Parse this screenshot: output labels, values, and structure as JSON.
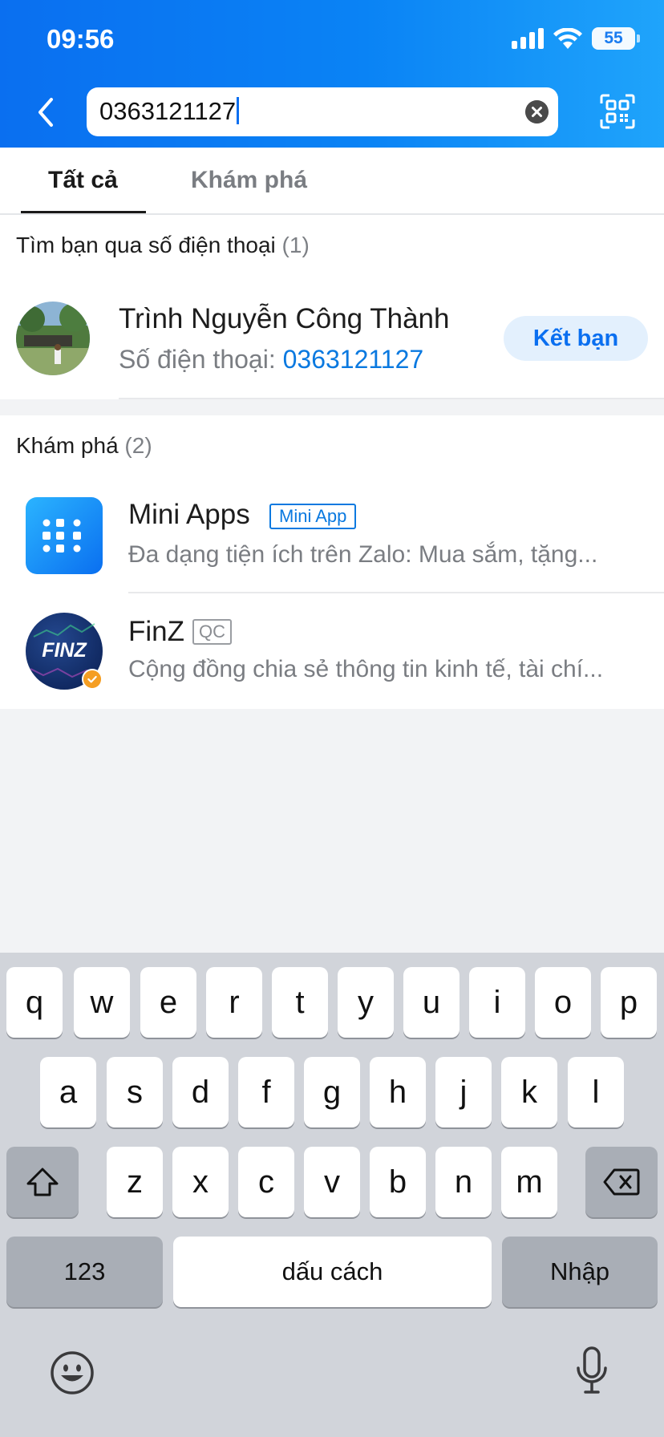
{
  "status_bar": {
    "time": "09:56",
    "battery": "55"
  },
  "search": {
    "value": "0363121127"
  },
  "tabs": [
    {
      "label": "Tất cả",
      "active": true
    },
    {
      "label": "Khám phá",
      "active": false
    }
  ],
  "phone_section": {
    "title": "Tìm bạn qua số điện thoại",
    "count": "(1)",
    "result": {
      "name": "Trình Nguyễn Công Thành",
      "phone_label": "Số điện thoại: ",
      "phone": "0363121127",
      "action_label": "Kết bạn"
    }
  },
  "discover_section": {
    "title": "Khám phá",
    "count": "(2)",
    "items": [
      {
        "title": "Mini Apps",
        "tag": "Mini App",
        "desc": "Đa dạng tiện ích trên Zalo: Mua sắm, tặng..."
      },
      {
        "title": "FinZ",
        "tag": "QC",
        "desc": "Cộng đồng chia sẻ thông tin kinh tế, tài chí...",
        "logo_text": "FINZ"
      }
    ]
  },
  "keyboard": {
    "row1": [
      "q",
      "w",
      "e",
      "r",
      "t",
      "y",
      "u",
      "i",
      "o",
      "p"
    ],
    "row2": [
      "a",
      "s",
      "d",
      "f",
      "g",
      "h",
      "j",
      "k",
      "l"
    ],
    "row3": [
      "z",
      "x",
      "c",
      "v",
      "b",
      "n",
      "m"
    ],
    "numbers_label": "123",
    "space_label": "dấu cách",
    "return_label": "Nhập"
  },
  "icons": {
    "shift": "shift-icon",
    "delete": "backspace-icon",
    "emoji": "emoji-icon",
    "mic": "microphone-icon",
    "back": "chevron-left-icon",
    "qr": "qr-code-icon",
    "clear": "clear-icon"
  },
  "colors": {
    "accent": "#0a6ff0",
    "header_gradient_end": "#1fa4fb",
    "keyboard_bg": "#d1d4da",
    "verified": "#f59e23"
  }
}
